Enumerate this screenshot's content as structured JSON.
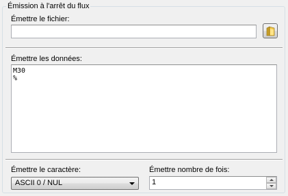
{
  "group": {
    "title": "Émission à l'arrêt du flux"
  },
  "file": {
    "label": "Émettre le fichier:",
    "value": "",
    "browse_icon": "folder-open-icon"
  },
  "data": {
    "label": "Émettre les données:",
    "lines": [
      "M30",
      "%"
    ]
  },
  "character": {
    "label": "Émettre le caractère:",
    "selected": "ASCII 0 / NUL"
  },
  "repeat": {
    "label": "Émettre nombre de fois:",
    "value": "1"
  },
  "colors": {
    "group_border": "#d5dfe5",
    "field_border": "#abadb3",
    "background": "#f0f0f0"
  }
}
